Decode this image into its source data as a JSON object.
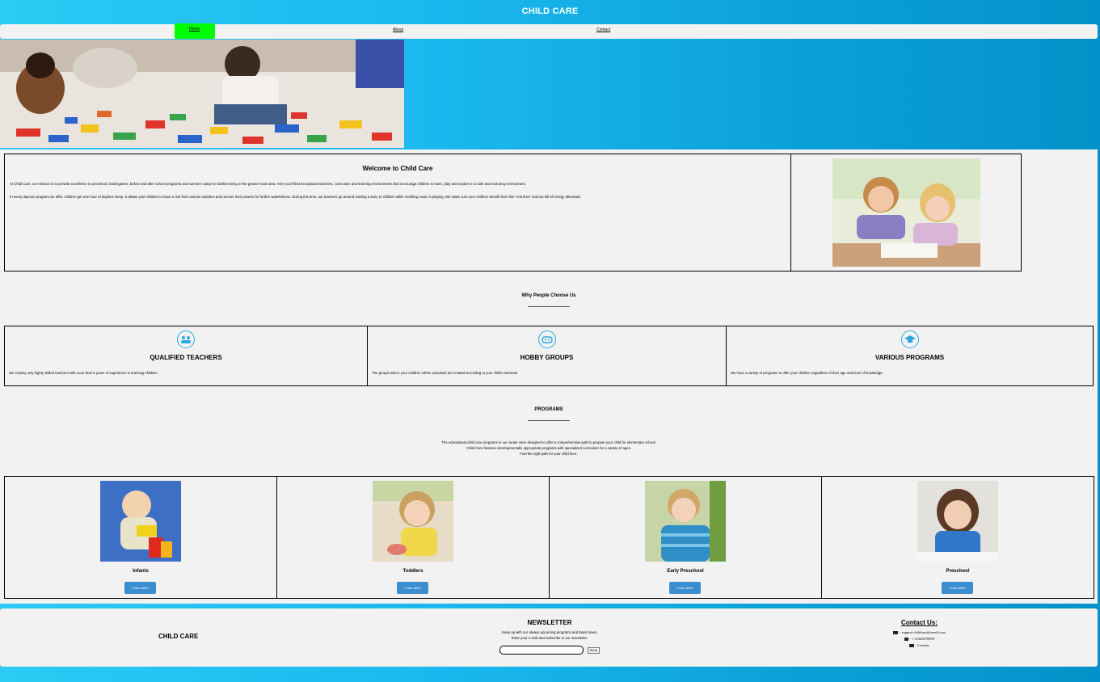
{
  "header": {
    "title": "CHILD CARE"
  },
  "nav": {
    "home": "Home",
    "about": "About",
    "contact": "Contact"
  },
  "welcome": {
    "title": "Welcome to Child Care",
    "p1": "At Child Care, our mission is to provide excellence in preschool, kindergarten, before and after school programs and summer camp for families living in the greater local area. Here you'll find exceptional teachers, curriculum and learning environments that encourage children to learn, play and explore in a safe and nurturing environment.",
    "p2": "In every daycare program we offer, children get one hour of daytime sleep. It allows your children to have a rest from various activities and recover their powers for further wakefulness. During this time, our teachers go around reading a story to children while soothing music is playing. We make sure your children benefit from this \"rest time\" and are full of energy afterward."
  },
  "why": {
    "title": "Why People Choose Us"
  },
  "features": [
    {
      "icon": "users-icon",
      "title": "QUALIFIED TEACHERS",
      "text": "We employ only highly skilled teachers with more than 5 years of experience in teaching children."
    },
    {
      "icon": "gamepad-icon",
      "title": "HOBBY GROUPS",
      "text": "The groups where your children will be educated are created according to your child's interests."
    },
    {
      "icon": "graduation-cap-icon",
      "title": "VARIOUS PROGRAMS",
      "text": "We have a variety of programs to offer your children regardless of their age and level of knowledge."
    }
  ],
  "programs": {
    "title": "PROGRAMS",
    "desc1": "The educational child care programs in our center were designed to offer a comprehensive path to prepare your child for elementary school.",
    "desc2": "Child Care features developmentally appropriate programs with specialized curriculum for a variety of ages.",
    "desc3": "Find the right path for your child here.",
    "button": "Learn More",
    "items": [
      {
        "label": "Infants"
      },
      {
        "label": "Toddlers"
      },
      {
        "label": "Early Preschool"
      },
      {
        "label": "Preschool"
      }
    ]
  },
  "footer": {
    "brand": "CHILD CARE",
    "newsletter_title": "NEWSLETTER",
    "newsletter_line1": "Keep up with our always upcoming programs and latest news.",
    "newsletter_line2": "Enter your e-mail and subscribe to our newsletter.",
    "send": "Send",
    "contact_title": "Contact Us:",
    "email": "- support.childcare@email.com",
    "phone": "- +12345678900",
    "address": "- London."
  }
}
